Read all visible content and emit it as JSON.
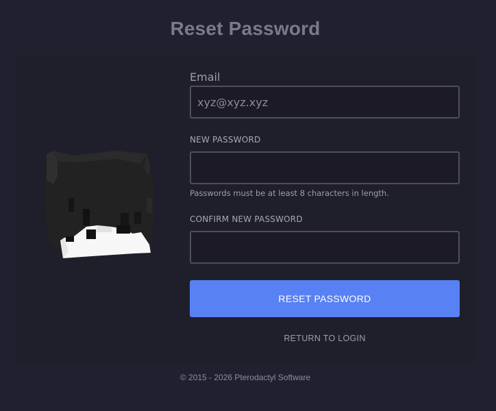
{
  "page": {
    "title": "Reset Password"
  },
  "form": {
    "email_label": "Email",
    "email_value": "xyz@xyz.xyz",
    "new_password_label": "NEW PASSWORD",
    "new_password_value": "",
    "new_password_help": "Passwords must be at least 8 characters in length.",
    "confirm_password_label": "CONFIRM NEW PASSWORD",
    "confirm_password_value": "",
    "submit_label": "RESET PASSWORD",
    "return_label": "RETURN TO LOGIN"
  },
  "footer": {
    "copyright": "© 2015 - 2026 Pterodactyl Software"
  },
  "colors": {
    "background": "#20202e",
    "card": "#1f1f2c",
    "accent": "#5881f3",
    "input_border": "#4e4e5c",
    "title": "#7a7a8c"
  },
  "icons": {
    "avatar": "pixel-character-head-icon"
  }
}
